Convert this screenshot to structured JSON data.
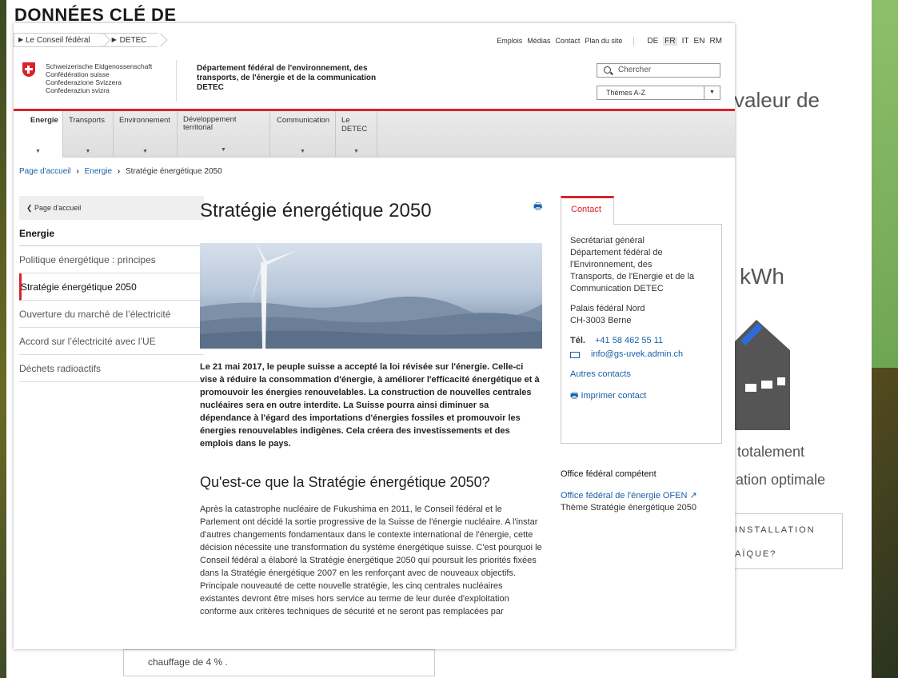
{
  "background": {
    "title": "DONNÉES CLÉ DE",
    "valeur": "valeur de",
    "kwh": "kWh",
    "totalement": "totalement",
    "optimale": "ation optimale",
    "installation": "INSTALLATION",
    "aique": "AÏQUE?",
    "chauffage": "chauffage de 4 % ."
  },
  "topbar": {
    "crumbs": [
      "Le Conseil fédéral",
      "DETEC"
    ],
    "links": [
      "Emplois",
      "Médias",
      "Contact",
      "Plan du site"
    ],
    "languages": [
      "DE",
      "FR",
      "IT",
      "EN",
      "RM"
    ],
    "active_language": "FR"
  },
  "header": {
    "confederation": [
      "Schweizerische Eidgenossenschaft",
      "Confédération suisse",
      "Confederazione Svizzera",
      "Confederaziun svizra"
    ],
    "department": "Département fédéral de l'environnement, des transports, de l'énergie et de la communication DETEC",
    "search_placeholder": "Chercher",
    "themes_label": "Thèmes A-Z"
  },
  "nav": {
    "items": [
      "Energie",
      "Transports",
      "Environnement",
      "Développement territorial",
      "Communication",
      "Le DETEC"
    ],
    "active": "Energie"
  },
  "breadcrumb": [
    "Page d'accueil",
    "Energie",
    "Stratégie énergétique 2050"
  ],
  "sidebar": {
    "back": "Page d'accueil",
    "heading": "Energie",
    "items": [
      "Politique énergétique : principes",
      "Stratégie énergétique 2050",
      "Ouverture du marché de l’électricité",
      "Accord sur l’électricité avec l’UE",
      "Déchets radioactifs"
    ],
    "active_index": 1
  },
  "main": {
    "title": "Stratégie énergétique 2050",
    "lead": "Le 21 mai 2017, le peuple suisse a accepté la loi révisée sur l'énergie. Celle-ci vise à réduire la consommation d'énergie, à améliorer l'efficacité énergétique et à promouvoir les énergies renouvelables. La construction de nouvelles centrales nucléaires sera en outre interdite. La Suisse pourra ainsi diminuer sa dépendance à l'égard des importations d'énergies fossiles et promouvoir les énergies renouvelables indigènes. Cela créera des investissements et des emplois dans le pays.",
    "subtitle": "Qu'est-ce que la Stratégie énergétique 2050?",
    "body": "Après la catastrophe nucléaire de Fukushima en 2011, le Conseil fédéral et le Parlement ont décidé la sortie progressive de la Suisse de l'énergie nucléaire. A l'instar d'autres changements fondamentaux dans le contexte international de l'énergie, cette décision nécessite une transformation du système énergétique suisse. C'est pourquoi le Conseil fédéral a élaboré la Stratégie énergétique 2050 qui poursuit les priorités fixées dans la Stratégie énergétique 2007 en les renforçant avec de nouveaux objectifs. Principale nouveauté de cette nouvelle stratégie, les cinq centrales nucléaires existantes devront être mises hors service au terme de leur durée d'exploitation conforme aux critères techniques de sécurité et ne seront pas remplacées par"
  },
  "contact": {
    "tab": "Contact",
    "lines": [
      "Secrétariat général",
      "Département fédéral de",
      "l'Environnement, des",
      "Transports, de l'Energie et de la",
      "Communication DETEC"
    ],
    "address": [
      "Palais fédéral Nord",
      "CH-3003 Berne"
    ],
    "tel_label": "Tél.",
    "tel": "+41 58 462 55 11",
    "email": "info@gs-uvek.admin.ch",
    "other_contacts": "Autres contacts",
    "print_contact": "Imprimer contact"
  },
  "office": {
    "heading": "Office fédéral compétent",
    "link": "Office fédéral de l'énergie OFEN",
    "theme": "Thème Stratégie énergétique 2050"
  },
  "colors": {
    "accent_red": "#d8232a",
    "link_blue": "#1a5fa8"
  }
}
